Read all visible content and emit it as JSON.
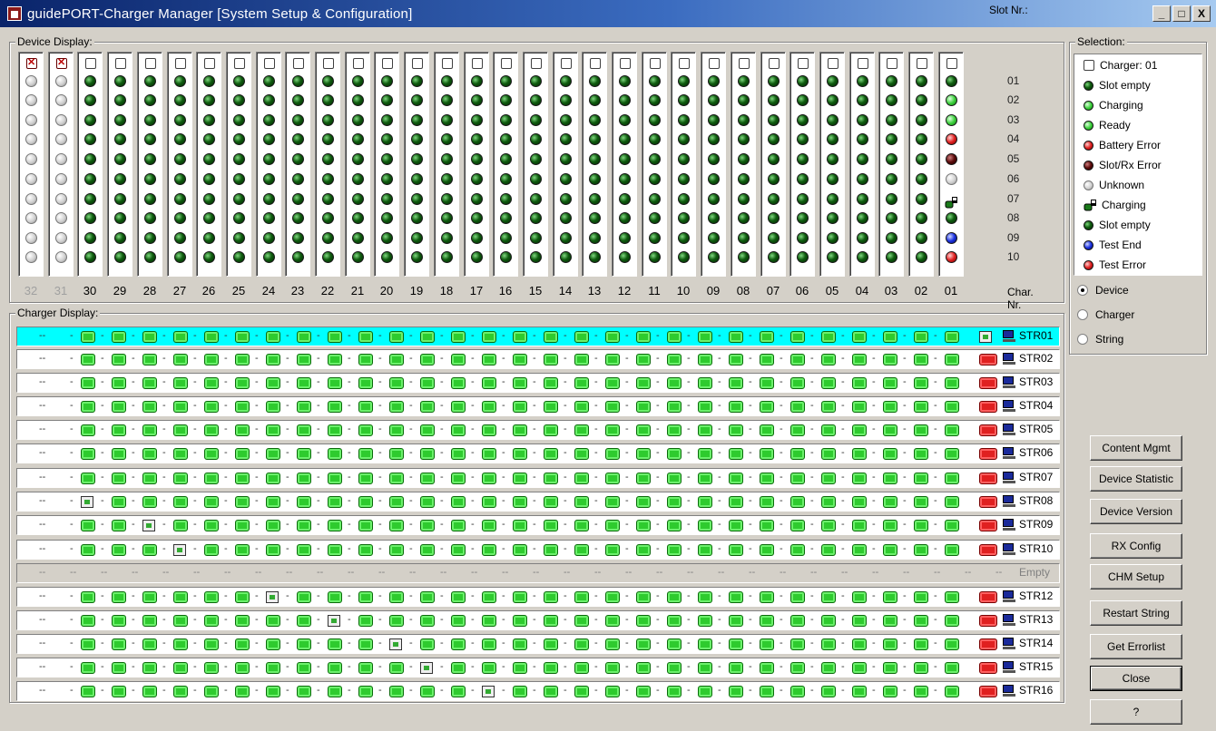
{
  "window": {
    "title": "guidePORT-Charger Manager [System Setup & Configuration]",
    "min": "_",
    "max": "□",
    "close": "X"
  },
  "device_display": {
    "label": "Device Display:",
    "slot_title": "Slot Nr.:",
    "char_title": "Char. Nr.",
    "slots": [
      "01",
      "02",
      "03",
      "04",
      "05",
      "06",
      "07",
      "08",
      "09",
      "10"
    ],
    "columns": [
      "32",
      "31",
      "30",
      "29",
      "28",
      "27",
      "26",
      "25",
      "24",
      "23",
      "22",
      "21",
      "20",
      "19",
      "18",
      "17",
      "16",
      "15",
      "14",
      "13",
      "12",
      "11",
      "10",
      "09",
      "08",
      "07",
      "06",
      "05",
      "04",
      "03",
      "02",
      "01"
    ],
    "last_column_states": [
      "dark",
      "green",
      "green",
      "red",
      "maroon",
      "grey",
      "charging-icon",
      "dark",
      "blue",
      "red"
    ]
  },
  "charger_display": {
    "label": "Charger Display:",
    "rows": [
      {
        "label": "STR01",
        "state": "selected"
      },
      {
        "label": "STR02"
      },
      {
        "label": "STR03"
      },
      {
        "label": "STR04"
      },
      {
        "label": "STR05"
      },
      {
        "label": "STR06"
      },
      {
        "label": "STR07"
      },
      {
        "label": "STR08"
      },
      {
        "label": "STR09"
      },
      {
        "label": "STR10"
      },
      {
        "label": "Empty",
        "state": "empty"
      },
      {
        "label": "STR12"
      },
      {
        "label": "STR13"
      },
      {
        "label": "STR14"
      },
      {
        "label": "STR15"
      },
      {
        "label": "STR16"
      }
    ]
  },
  "selection": {
    "label": "Selection:",
    "legend": [
      {
        "text": "Charger: 01",
        "kind": "charger"
      },
      {
        "text": "Slot empty",
        "kind": "dark"
      },
      {
        "text": "Charging",
        "kind": "green"
      },
      {
        "text": "Ready",
        "kind": "green"
      },
      {
        "text": "Battery Error",
        "kind": "red"
      },
      {
        "text": "Slot/Rx Error",
        "kind": "maroon"
      },
      {
        "text": "Unknown",
        "kind": "grey"
      },
      {
        "text": "Charging",
        "kind": "charging-icon"
      },
      {
        "text": "Slot empty",
        "kind": "dark"
      },
      {
        "text": "Test End",
        "kind": "blue"
      },
      {
        "text": "Test Error",
        "kind": "red"
      }
    ],
    "radios": [
      {
        "label": "Device",
        "checked": true
      },
      {
        "label": "Charger",
        "checked": false
      },
      {
        "label": "String",
        "checked": false
      }
    ]
  },
  "buttons": {
    "content_mgmt": "Content Mgmt",
    "device_statistic": "Device Statistic",
    "device_version": "Device Version",
    "rx_config": "RX Config",
    "chm_setup": "CHM Setup",
    "restart_string": "Restart String",
    "get_errorlist": "Get Errorlist",
    "close": "Close",
    "help": "?"
  },
  "colors": {
    "selected_row": "#00ffff",
    "charger_green": "#2ecb2e",
    "charger_red": "#e02020"
  }
}
